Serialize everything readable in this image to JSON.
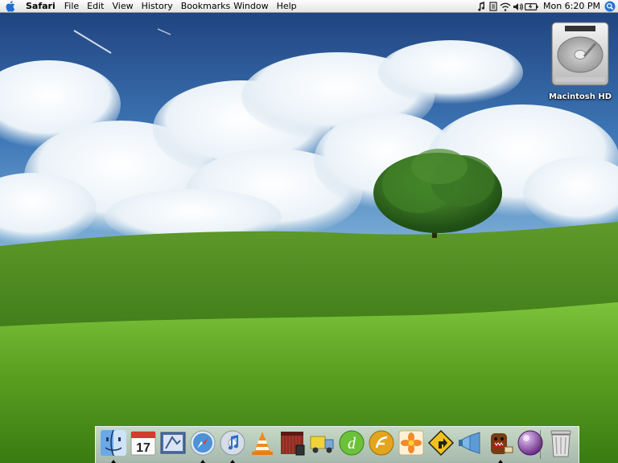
{
  "menubar": {
    "apple_icon": "apple-logo-icon",
    "app_name": "Safari",
    "menus": [
      "File",
      "Edit",
      "View",
      "History",
      "Bookmarks",
      "Window",
      "Help"
    ],
    "status_icons": [
      "music-note-icon",
      "script-icon",
      "wifi-icon",
      "volume-icon",
      "battery-icon"
    ],
    "clock": "Mon 6:20 PM",
    "spotlight_icon": "spotlight-icon"
  },
  "desktop": {
    "wallpaper": "green-hill-tree-sky",
    "icons": [
      {
        "label": "Macintosh HD",
        "icon": "hard-drive-icon"
      }
    ]
  },
  "dock": {
    "items": [
      {
        "name": "Finder",
        "icon": "finder-icon",
        "running": true
      },
      {
        "name": "iCal",
        "icon": "ical-icon",
        "date": "17",
        "running": false
      },
      {
        "name": "Mail",
        "icon": "mail-icon",
        "running": false
      },
      {
        "name": "Safari",
        "icon": "safari-icon",
        "running": true
      },
      {
        "name": "iTunes",
        "icon": "itunes-icon",
        "running": true
      },
      {
        "name": "VLC",
        "icon": "vlc-icon",
        "running": false
      },
      {
        "name": "iMovie",
        "icon": "imovie-icon",
        "running": false
      },
      {
        "name": "Transmit",
        "icon": "transmit-truck-icon",
        "running": false
      },
      {
        "name": "Dreamweaver",
        "icon": "dreamweaver-icon",
        "running": false
      },
      {
        "name": "Flash",
        "icon": "flash-icon",
        "running": false
      },
      {
        "name": "Photos",
        "icon": "flower-icon",
        "running": false
      },
      {
        "name": "Cyberduck",
        "icon": "road-sign-icon",
        "running": false
      },
      {
        "name": "Adium",
        "icon": "megaphone-icon",
        "running": false
      },
      {
        "name": "Domo",
        "icon": "domo-icon",
        "running": true
      },
      {
        "name": "Orb",
        "icon": "purple-orb-icon",
        "running": false
      }
    ],
    "trash": {
      "name": "Trash",
      "icon": "trash-icon"
    }
  }
}
